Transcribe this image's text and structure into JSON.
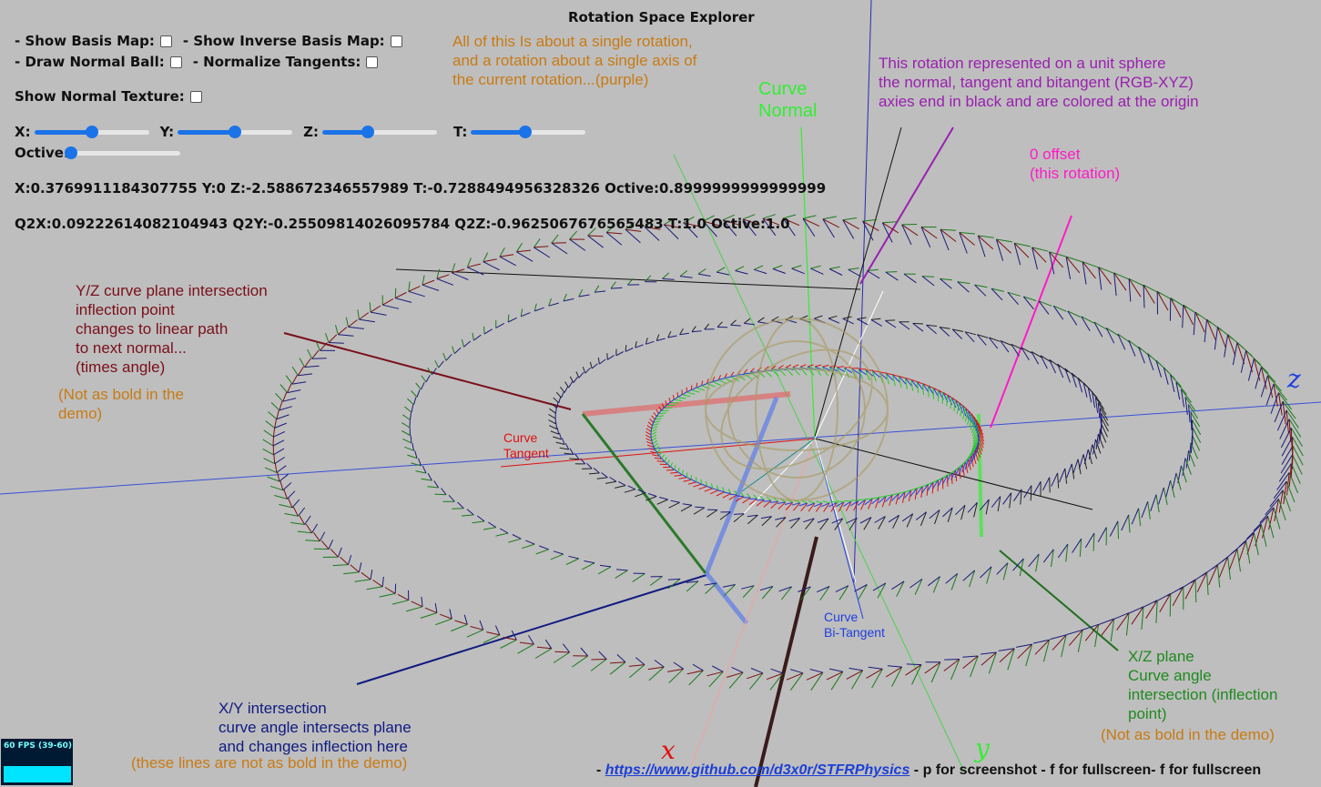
{
  "app": {
    "title": "Rotation Space Explorer"
  },
  "controls": {
    "show_basis_map": "- Show Basis Map:",
    "show_inverse_basis_map": "- Show Inverse Basis Map:",
    "draw_normal_ball": "- Draw Normal Ball:",
    "normalize_tangents": "- Normalize Tangents:",
    "show_normal_texture": "Show Normal Texture:",
    "sliders": {
      "x": {
        "label": "X:",
        "value": 0.5
      },
      "y": {
        "label": "Y:",
        "value": 0.5
      },
      "z": {
        "label": "Z:",
        "value": 0.4
      },
      "t": {
        "label": "T:",
        "value": 0.47
      },
      "octive": {
        "label": "Octive:",
        "value": 0.0
      }
    }
  },
  "readouts": {
    "line1": "X:0.3769911184307755 Y:0 Z:-2.588672346557989 T:-0.7288494956328326 Octive:0.8999999999999999",
    "line2": "Q2X:0.09222614082104943 Q2Y:-0.25509814026095784 Q2Z:-0.9625067676565483 T:1.0 Octive:1.0"
  },
  "annotations": {
    "single_rotation": [
      "All of this Is about a single rotation,",
      "and a rotation about a single axis of",
      "the current rotation...(purple)"
    ],
    "curve_normal": [
      "Curve",
      "Normal"
    ],
    "unit_sphere": [
      "This rotation represented on a unit sphere",
      "the normal, tangent and bitangent (RGB-XYZ)",
      "axies end in black and are colored at the origin"
    ],
    "zero_offset": [
      "0 offset",
      "(this rotation)"
    ],
    "yz_plane": [
      "Y/Z curve plane intersection",
      "inflection point",
      "changes to linear path",
      "to next normal...",
      "(times angle)"
    ],
    "yz_note": [
      "(Not as bold in the",
      "demo)"
    ],
    "curve_tangent": [
      "Curve",
      "Tangent"
    ],
    "curve_bitangent": [
      "Curve",
      "Bi-Tangent"
    ],
    "xz_plane": [
      "X/Z plane",
      "Curve angle",
      "intersection (inflection",
      "point)"
    ],
    "xz_note": "(Not as bold in the demo)",
    "xy_intersection": [
      "X/Y intersection",
      "curve angle intersects plane",
      "and changes inflection here"
    ],
    "xy_note": "(these lines are not as bold in the demo)"
  },
  "axis_labels": {
    "x": "x",
    "y": "y",
    "z": "z"
  },
  "fps": {
    "text": "60 FPS (39-60)"
  },
  "footer": {
    "prefix": "-",
    "link": "https://www.github.com/d3x0r/STFRPhysics",
    "rest": "- p for screenshot - f for fullscreen- f for fullscreen"
  },
  "colors": {
    "background": "#bebebe",
    "orange": "#c87b14",
    "purple": "#9a1fb0",
    "magenta": "#ff1ac6",
    "maroon": "#7a0f1a",
    "green_text": "#1f8a1f",
    "navy": "#101a80",
    "red": "#e01010",
    "blue": "#1f3fe0",
    "bright_green": "#33ee33"
  }
}
